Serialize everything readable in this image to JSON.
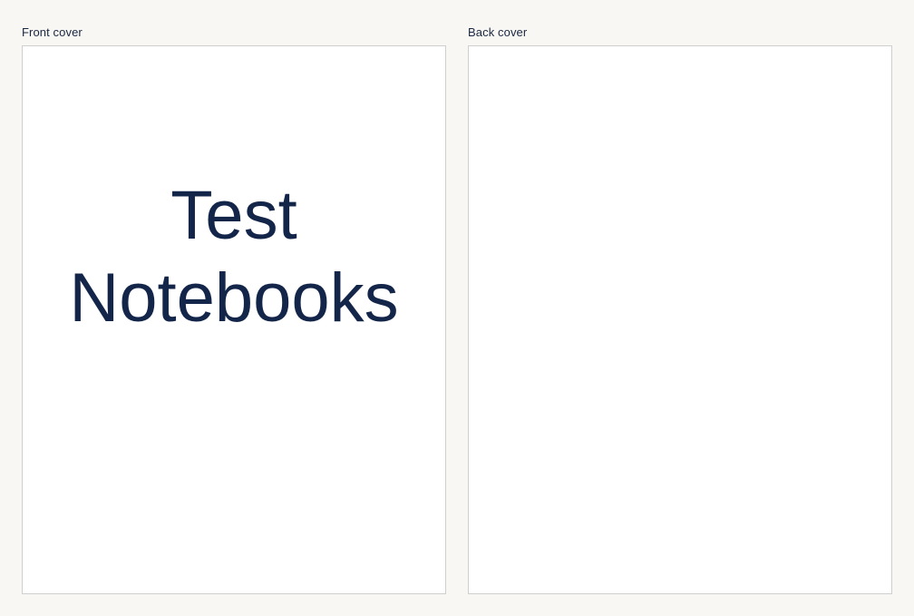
{
  "front_cover": {
    "label": "Front cover",
    "title": "Test\nNotebooks"
  },
  "back_cover": {
    "label": "Back cover"
  }
}
